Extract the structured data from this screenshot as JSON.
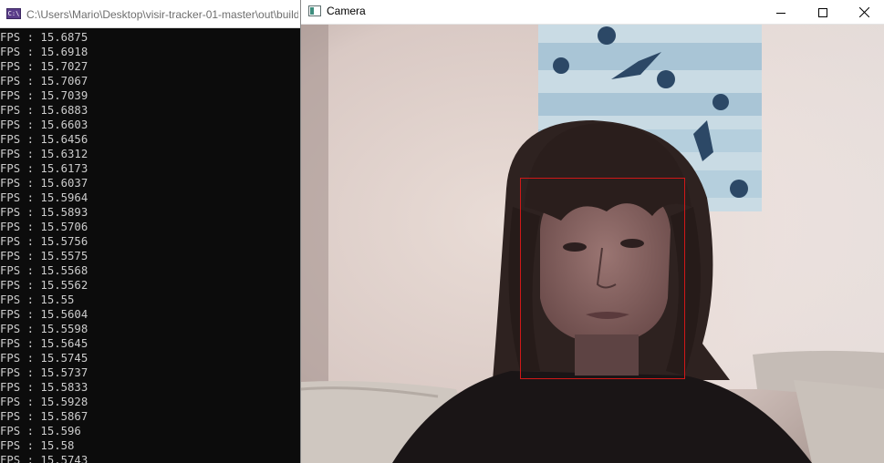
{
  "console": {
    "title": "C:\\Users\\Mario\\Desktop\\visir-tracker-01-master\\out\\build",
    "icon": "cmd-icon",
    "label": "FPS",
    "separator": " : ",
    "lines": [
      "15.6875",
      "15.6918",
      "15.7027",
      "15.7067",
      "15.7039",
      "15.6883",
      "15.6603",
      "15.6456",
      "15.6312",
      "15.6173",
      "15.6037",
      "15.5964",
      "15.5893",
      "15.5706",
      "15.5756",
      "15.5575",
      "15.5568",
      "15.5562",
      "15.55",
      "15.5604",
      "15.5598",
      "15.5645",
      "15.5745",
      "15.5737",
      "15.5833",
      "15.5928",
      "15.5867",
      "15.596",
      "15.58",
      "15.5743"
    ]
  },
  "camera": {
    "title": "Camera",
    "icon": "camera-window-icon",
    "controls": {
      "minimize": "minimize-icon",
      "maximize": "maximize-icon",
      "close": "close-icon"
    },
    "detection_color": "#d01818"
  }
}
